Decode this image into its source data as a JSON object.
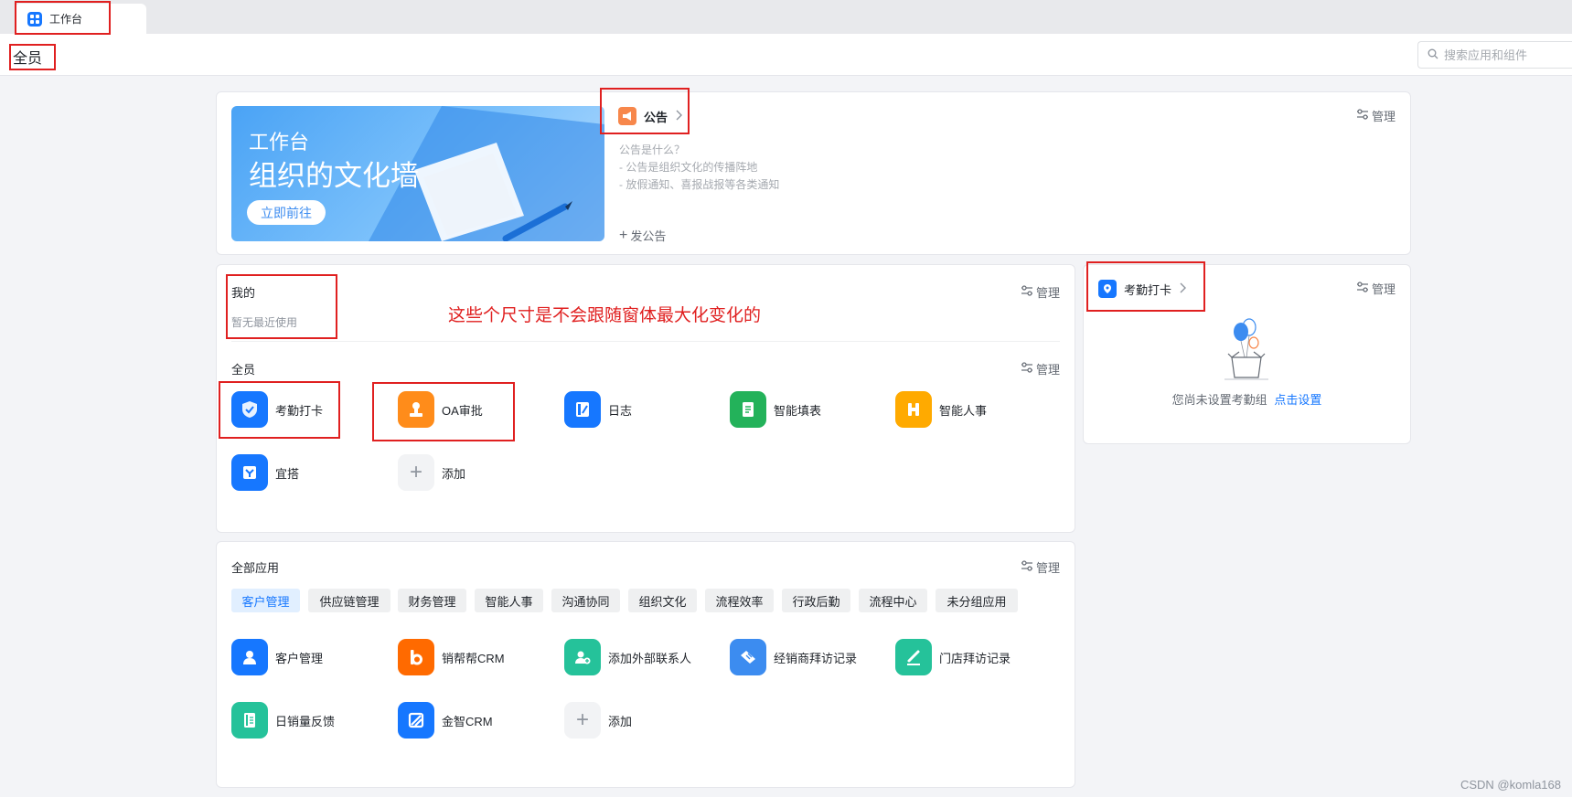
{
  "tab": {
    "label": "工作台"
  },
  "topbar": {
    "title": "全员",
    "search_placeholder": "搜索应用和组件"
  },
  "announcement": {
    "banner_small": "工作台",
    "banner_big": "组织的文化墙",
    "banner_button": "立即前往",
    "title": "公告",
    "lines": [
      "公告是什么？",
      "- 公告是组织文化的传播阵地",
      "- 放假通知、喜报战报等各类通知"
    ],
    "post_label": "发公告",
    "manage": "管理"
  },
  "mine": {
    "title": "我的",
    "empty": "暂无最近使用",
    "manage": "管理"
  },
  "all_members": {
    "title": "全员",
    "manage": "管理",
    "apps": [
      {
        "label": "考勤打卡",
        "color": "#1677ff",
        "icon": "shield-check-icon"
      },
      {
        "label": "OA审批",
        "color": "#ff8c1a",
        "icon": "stamp-icon"
      },
      {
        "label": "日志",
        "color": "#1677ff",
        "icon": "notebook-icon"
      },
      {
        "label": "智能填表",
        "color": "#23b25a",
        "icon": "form-icon"
      },
      {
        "label": "智能人事",
        "color": "#ffaa00",
        "icon": "h-letter-icon"
      },
      {
        "label": "宜搭",
        "color": "#1677ff",
        "icon": "yida-icon"
      },
      {
        "label": "添加",
        "color": "#f2f3f5",
        "icon": "plus-icon"
      }
    ]
  },
  "note": "这些个尺寸是不会跟随窗体最大化变化的",
  "attendance": {
    "title": "考勤打卡",
    "manage": "管理",
    "empty_text": "您尚未设置考勤组",
    "setup_link": "点击设置"
  },
  "all_apps": {
    "title": "全部应用",
    "manage": "管理",
    "categories": [
      "客户管理",
      "供应链管理",
      "财务管理",
      "智能人事",
      "沟通协同",
      "组织文化",
      "流程效率",
      "行政后勤",
      "流程中心",
      "未分组应用"
    ],
    "apps": [
      {
        "label": "客户管理",
        "color": "#1677ff",
        "icon": "customer-icon"
      },
      {
        "label": "销帮帮CRM",
        "color": "#ff6a00",
        "icon": "b-letter-icon"
      },
      {
        "label": "添加外部联系人",
        "color": "#25c29a",
        "icon": "add-contact-icon"
      },
      {
        "label": "经销商拜访记录",
        "color": "#3c8cf0",
        "icon": "handshake-icon"
      },
      {
        "label": "门店拜访记录",
        "color": "#25c29a",
        "icon": "pen-icon"
      },
      {
        "label": "日销量反馈",
        "color": "#25c29a",
        "icon": "ledger-icon"
      },
      {
        "label": "金智CRM",
        "color": "#1677ff",
        "icon": "jinzhi-icon"
      },
      {
        "label": "添加",
        "color": "#f2f3f5",
        "icon": "plus-icon"
      }
    ]
  },
  "watermark": "CSDN @komla168"
}
